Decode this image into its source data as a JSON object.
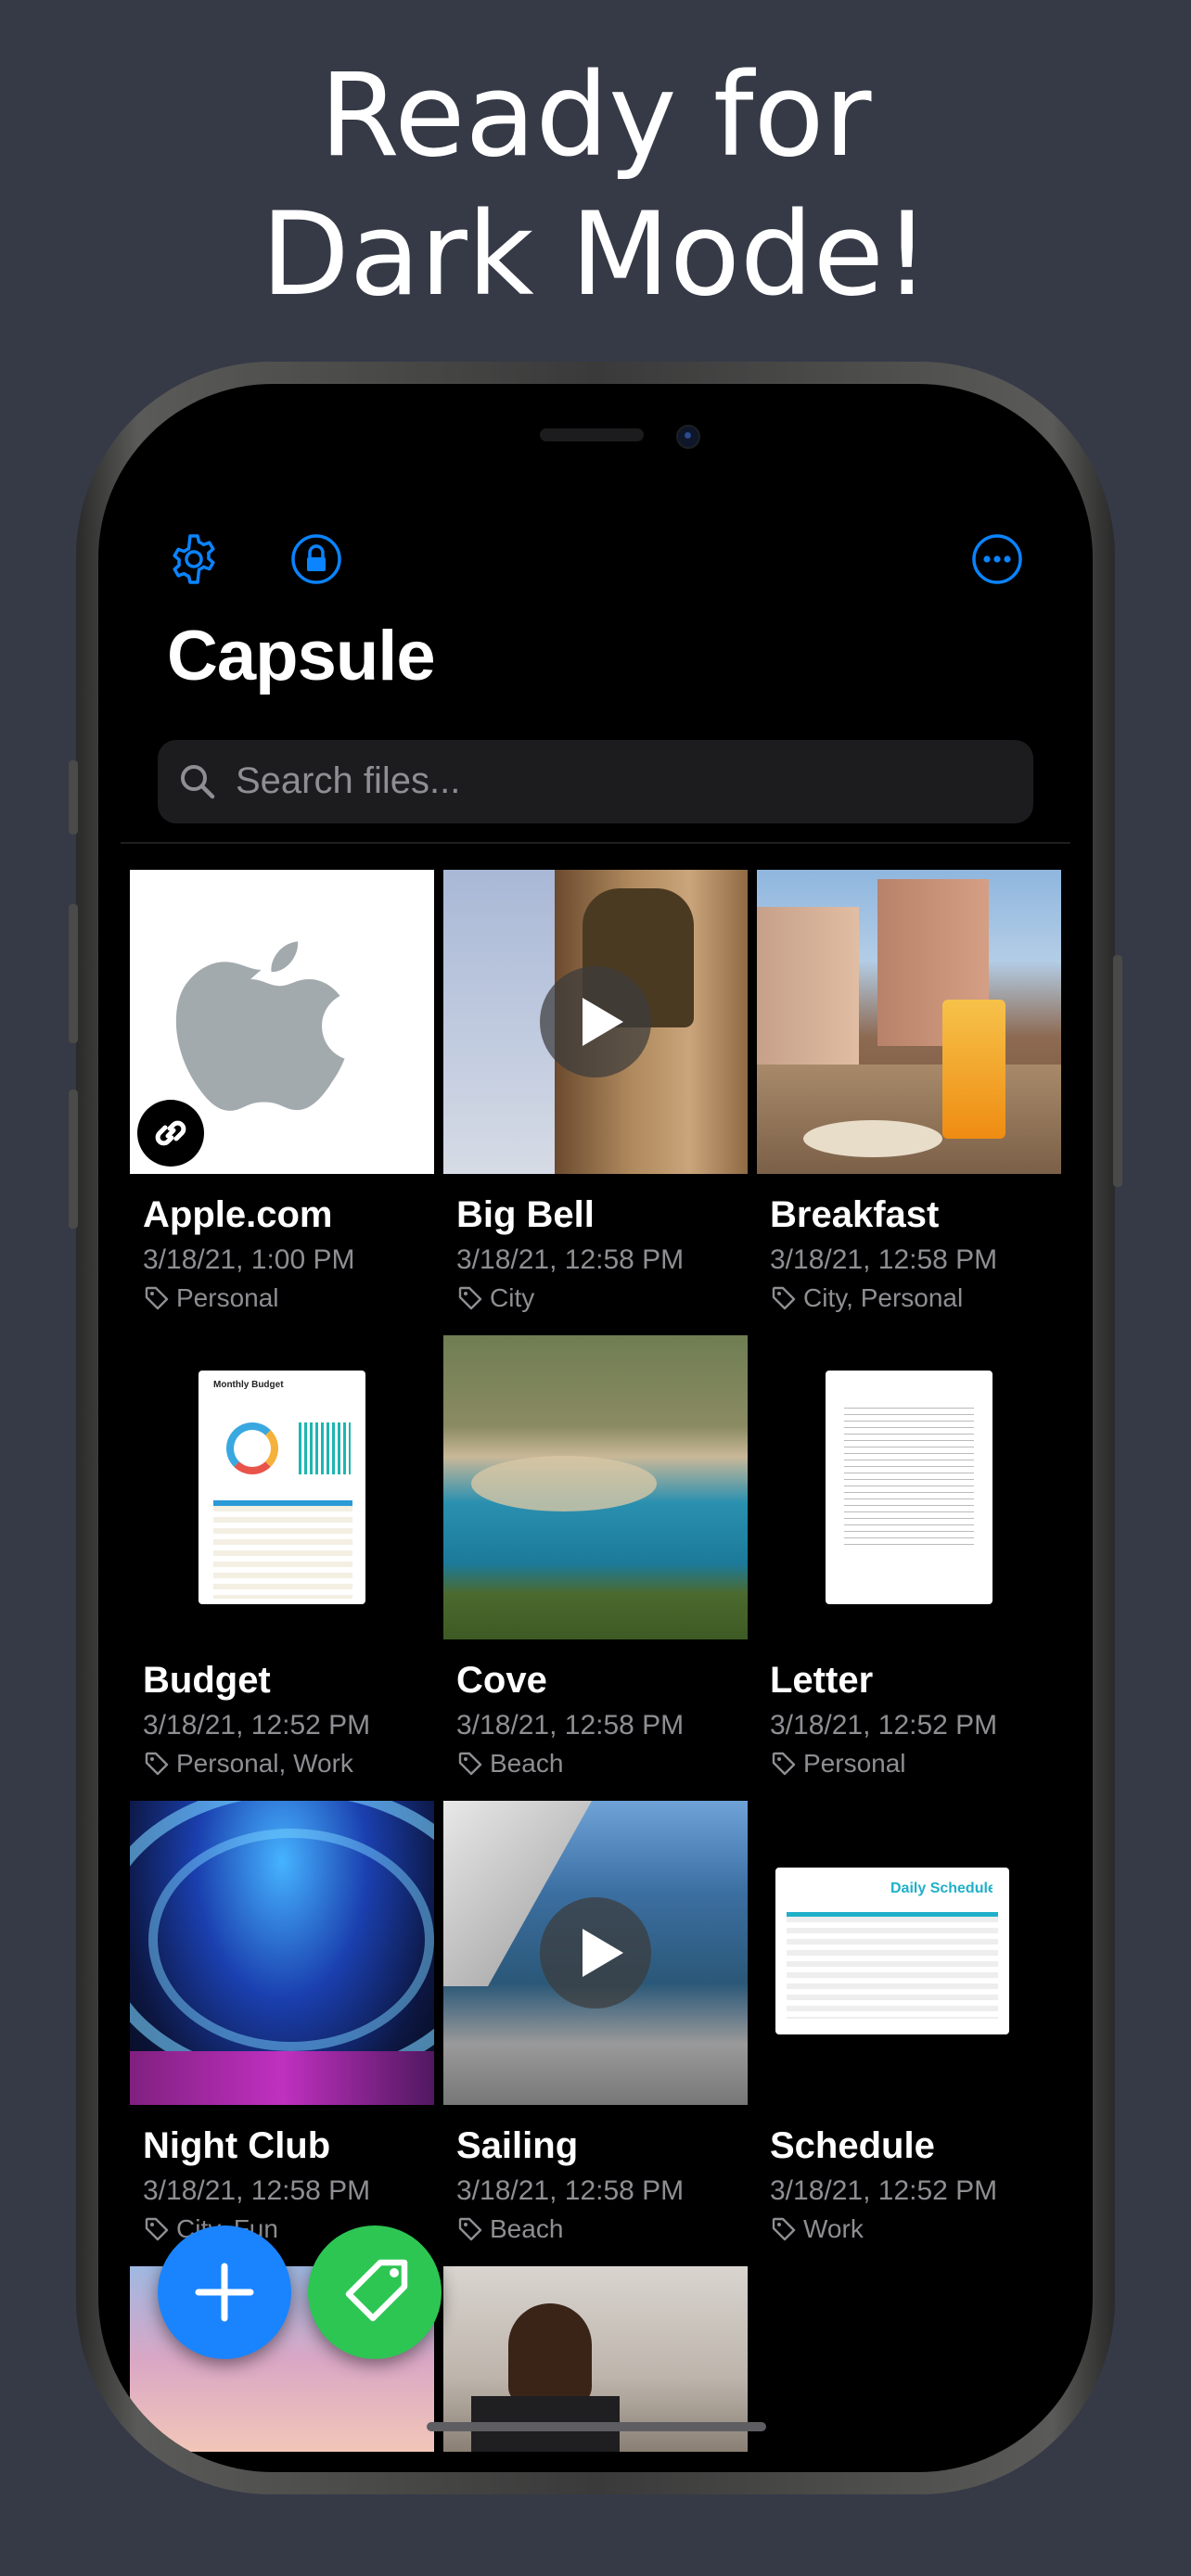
{
  "headline": {
    "line1": "Ready for",
    "line2": "Dark Mode!"
  },
  "app": {
    "title": "Capsule"
  },
  "toolbar": {
    "settings_icon": "gear-icon",
    "lock_icon": "lock-icon",
    "more_icon": "ellipsis-circle-icon"
  },
  "search": {
    "placeholder": "Search files..."
  },
  "colors": {
    "accent": "#0a84ff",
    "fab_add": "#1a84ff",
    "fab_tag": "#2dc653",
    "background": "#363a47"
  },
  "files": [
    {
      "name": "Apple.com",
      "date": "3/18/21, 1:00 PM",
      "tags": "Personal"
    },
    {
      "name": "Big Bell",
      "date": "3/18/21, 12:58 PM",
      "tags": "City"
    },
    {
      "name": "Breakfast",
      "date": "3/18/21, 12:58 PM",
      "tags": "City, Personal"
    },
    {
      "name": "Budget",
      "date": "3/18/21, 12:52 PM",
      "tags": "Personal, Work"
    },
    {
      "name": "Cove",
      "date": "3/18/21, 12:58 PM",
      "tags": "Beach"
    },
    {
      "name": "Letter",
      "date": "3/18/21, 12:52 PM",
      "tags": "Personal"
    },
    {
      "name": "Night Club",
      "date": "3/18/21, 12:58 PM",
      "tags": "City, Fun"
    },
    {
      "name": "Sailing",
      "date": "3/18/21, 12:58 PM",
      "tags": "Beach"
    },
    {
      "name": "Schedule",
      "date": "3/18/21, 12:52 PM",
      "tags": "Work"
    }
  ],
  "thumbnails": {
    "budget_title": "Monthly Budget",
    "schedule_title": "Daily Schedule"
  }
}
